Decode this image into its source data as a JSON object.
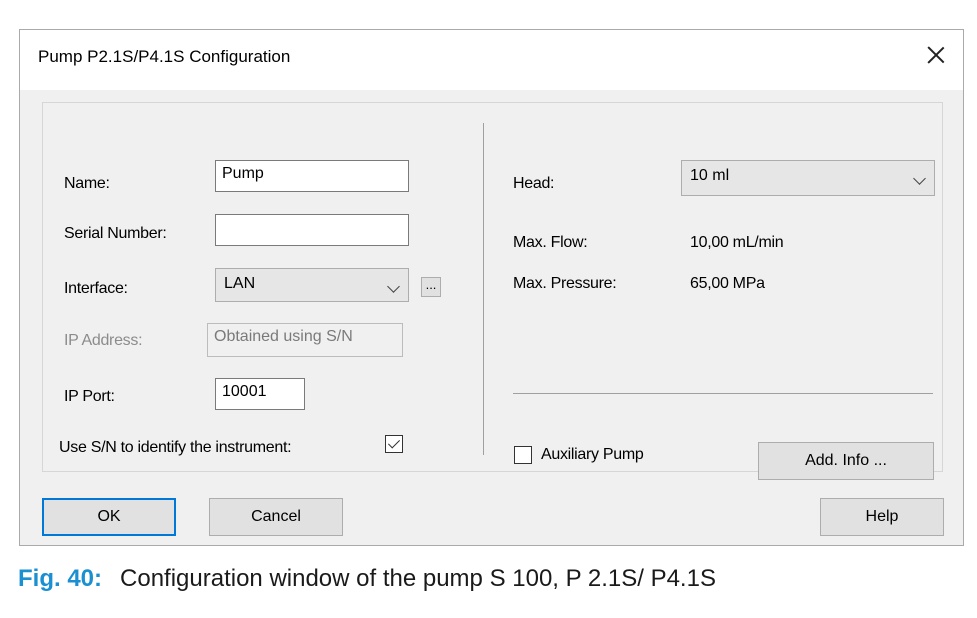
{
  "dialog": {
    "title": "Pump P2.1S/P4.1S Configuration"
  },
  "left": {
    "name_label": "Name:",
    "name_value": "Pump",
    "serial_label": "Serial Number:",
    "serial_value": "",
    "interface_label": "Interface:",
    "interface_value": "LAN",
    "interface_more": "...",
    "ip_address_label": "IP Address:",
    "ip_address_value": "Obtained using S/N",
    "ip_port_label": "IP Port:",
    "ip_port_value": "10001",
    "use_sn_label": "Use S/N to identify the instrument:",
    "use_sn_checked": true
  },
  "right": {
    "head_label": "Head:",
    "head_value": "10 ml",
    "max_flow_label": "Max. Flow:",
    "max_flow_value": "10,00 mL/min",
    "max_pressure_label": "Max. Pressure:",
    "max_pressure_value": "65,00 MPa",
    "aux_pump_label": "Auxiliary Pump",
    "aux_pump_checked": false,
    "add_info_label": "Add. Info ..."
  },
  "buttons": {
    "ok": "OK",
    "cancel": "Cancel",
    "help": "Help"
  },
  "caption": {
    "fig_label": "Fig. 40:",
    "text": "Configuration window of the pump S 100, P 2.1S/ P4.1S"
  },
  "colors": {
    "accent": "#0078d7",
    "caption_fig": "#1a8fd1",
    "dialog_bg": "#f0f0f0"
  }
}
